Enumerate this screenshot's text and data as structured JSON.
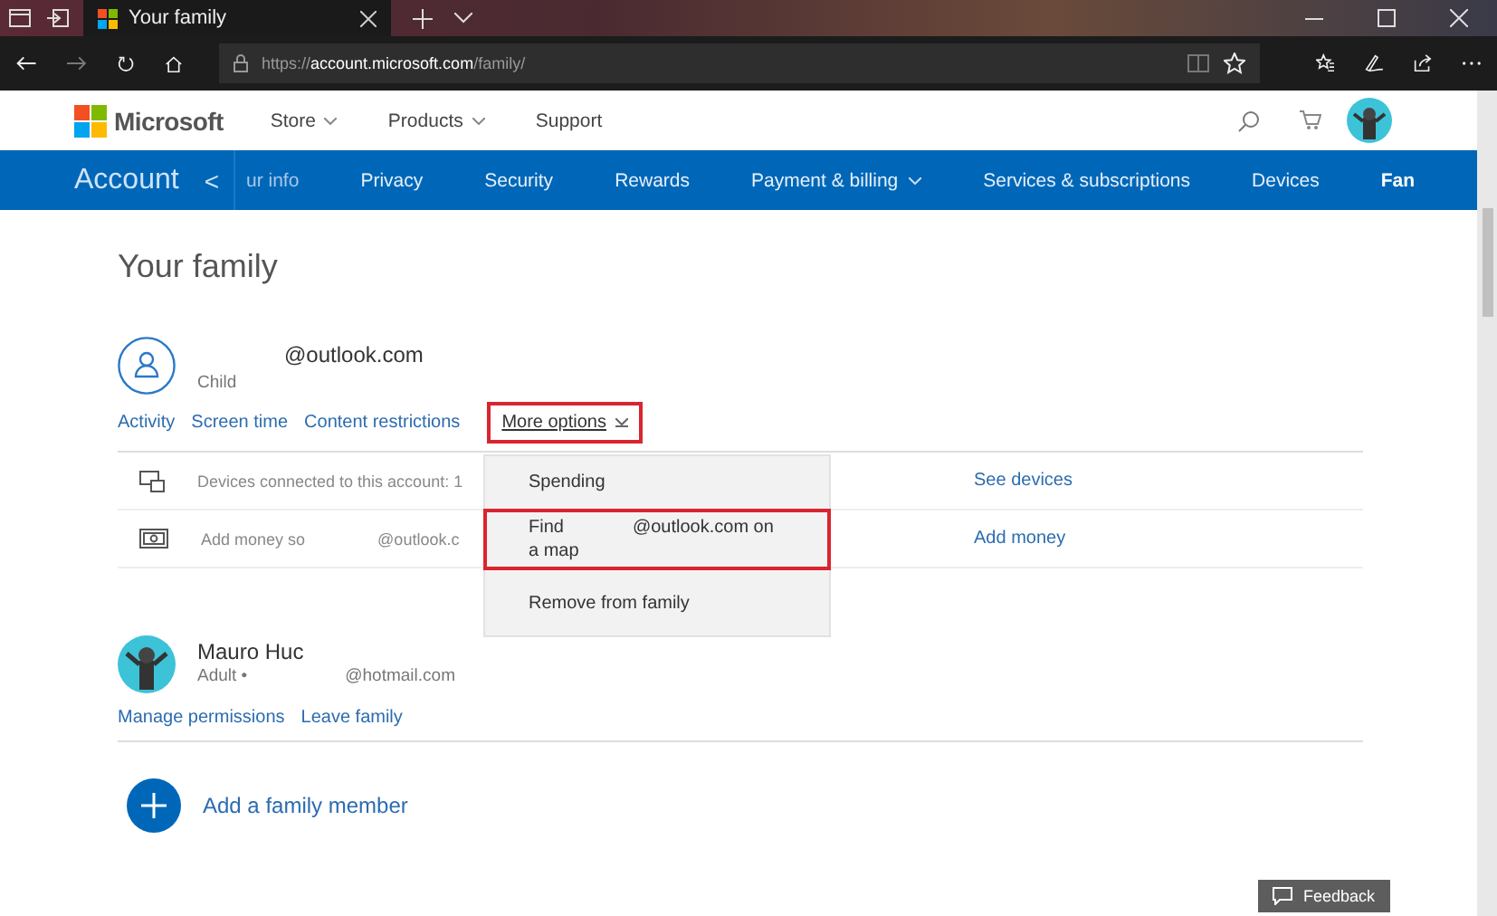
{
  "browser": {
    "tab_title": "Your family",
    "url_prefix": "https://",
    "url_host": "account.microsoft.com",
    "url_path": "/family/"
  },
  "header": {
    "brand": "Microsoft",
    "menu": [
      {
        "label": "Store",
        "dropdown": true
      },
      {
        "label": "Products",
        "dropdown": true
      },
      {
        "label": "Support",
        "dropdown": false
      }
    ]
  },
  "account_nav": {
    "title": "Account",
    "back": "<",
    "items": [
      {
        "label": "ur info",
        "selected": false,
        "dropdown": false
      },
      {
        "label": "Privacy",
        "selected": false,
        "dropdown": false
      },
      {
        "label": "Security",
        "selected": false,
        "dropdown": false
      },
      {
        "label": "Rewards",
        "selected": false,
        "dropdown": false
      },
      {
        "label": "Payment & billing",
        "selected": false,
        "dropdown": true
      },
      {
        "label": "Services & subscriptions",
        "selected": false,
        "dropdown": false
      },
      {
        "label": "Devices",
        "selected": false,
        "dropdown": false
      },
      {
        "label": "Fan",
        "selected": true,
        "dropdown": false
      }
    ]
  },
  "page_title": "Your family",
  "child": {
    "email": "@outlook.com",
    "role": "Child",
    "links": [
      {
        "label": "Activity",
        "highlighted": false
      },
      {
        "label": "Screen time",
        "highlighted": false
      },
      {
        "label": "Content restrictions",
        "highlighted": false
      },
      {
        "label": "More options",
        "highlighted": true
      }
    ],
    "rows": [
      {
        "kind": "devices",
        "text": "Devices connected to this account: 1",
        "action": "See devices"
      },
      {
        "kind": "money",
        "text": "Add money so",
        "extra": "@outlook.c",
        "action": "Add money"
      }
    ]
  },
  "dropdown": [
    {
      "label": "Spending",
      "highlighted": false
    },
    {
      "label": "Find",
      "label_2": "@outlook.com on a map",
      "highlighted": true
    },
    {
      "label": "Remove from family",
      "highlighted": false
    }
  ],
  "adult": {
    "name": "Mauro Huc",
    "role": "Adult •",
    "email": "@hotmail.com",
    "links": [
      "Manage permissions",
      "Leave family"
    ]
  },
  "add_member": "Add a family member",
  "feedback": "Feedback"
}
